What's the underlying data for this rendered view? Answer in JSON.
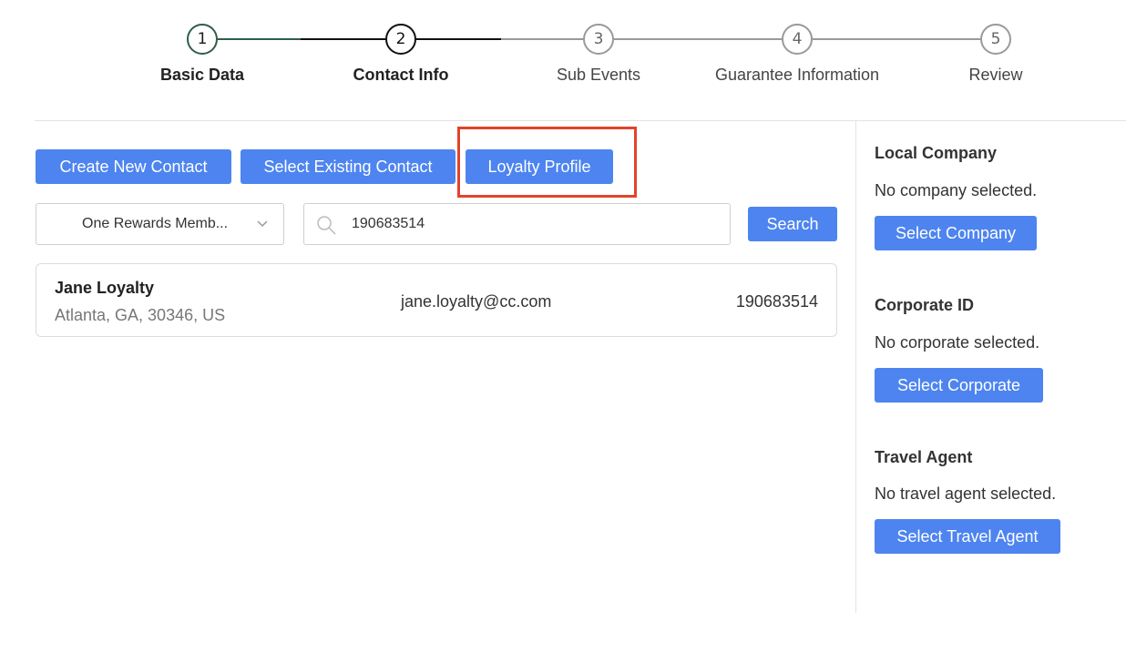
{
  "stepper": {
    "steps": [
      {
        "number": "1",
        "label": "Basic Data"
      },
      {
        "number": "2",
        "label": "Contact Info"
      },
      {
        "number": "3",
        "label": "Sub Events"
      },
      {
        "number": "4",
        "label": "Guarantee Information"
      },
      {
        "number": "5",
        "label": "Review"
      }
    ],
    "colors": {
      "completed": "#2e5e48",
      "active": "#111111",
      "pending": "#9a9a9a"
    }
  },
  "actions": {
    "create_new_contact": "Create New Contact",
    "select_existing_contact": "Select Existing Contact",
    "loyalty_profile": "Loyalty Profile"
  },
  "search": {
    "filter_selected": "One Rewards Memb...",
    "query": "190683514",
    "button_label": "Search"
  },
  "results": [
    {
      "name": "Jane Loyalty",
      "address": "Atlanta, GA, 30346, US",
      "email": "jane.loyalty@cc.com",
      "member_id": "190683514"
    }
  ],
  "sidebar": {
    "local_company": {
      "title": "Local Company",
      "status": "No company selected.",
      "button": "Select Company"
    },
    "corporate": {
      "title": "Corporate ID",
      "status": "No corporate selected.",
      "button": "Select Corporate"
    },
    "travel_agent": {
      "title": "Travel Agent",
      "status": "No travel agent selected.",
      "button": "Select Travel Agent"
    }
  },
  "theme": {
    "primary": "#4d84f0",
    "highlight": "#e2432a"
  }
}
